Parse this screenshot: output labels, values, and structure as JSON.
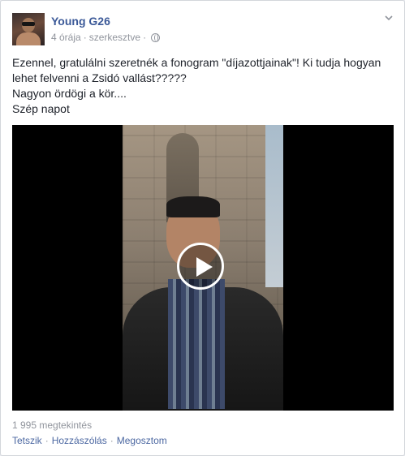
{
  "post": {
    "author": "Young G26",
    "time": "4 órája",
    "edited": "szerkesztve",
    "separator": "·",
    "body_lines": [
      "Ezennel, gratulálni szeretnék a fonogram \"díjazottjainak\"! Ki tudja hogyan",
      "lehet felvenni a Zsidó vallást?????",
      "Nagyon ördögi a kör....",
      "Szép napot"
    ]
  },
  "video": {
    "views": "1 995 megtekintés"
  },
  "actions": {
    "like": "Tetszik",
    "comment": "Hozzászólás",
    "share": "Megosztom",
    "separator": "·"
  },
  "icons": {
    "menu": "chevron-down-icon",
    "privacy": "globe-icon",
    "play": "play-icon"
  }
}
